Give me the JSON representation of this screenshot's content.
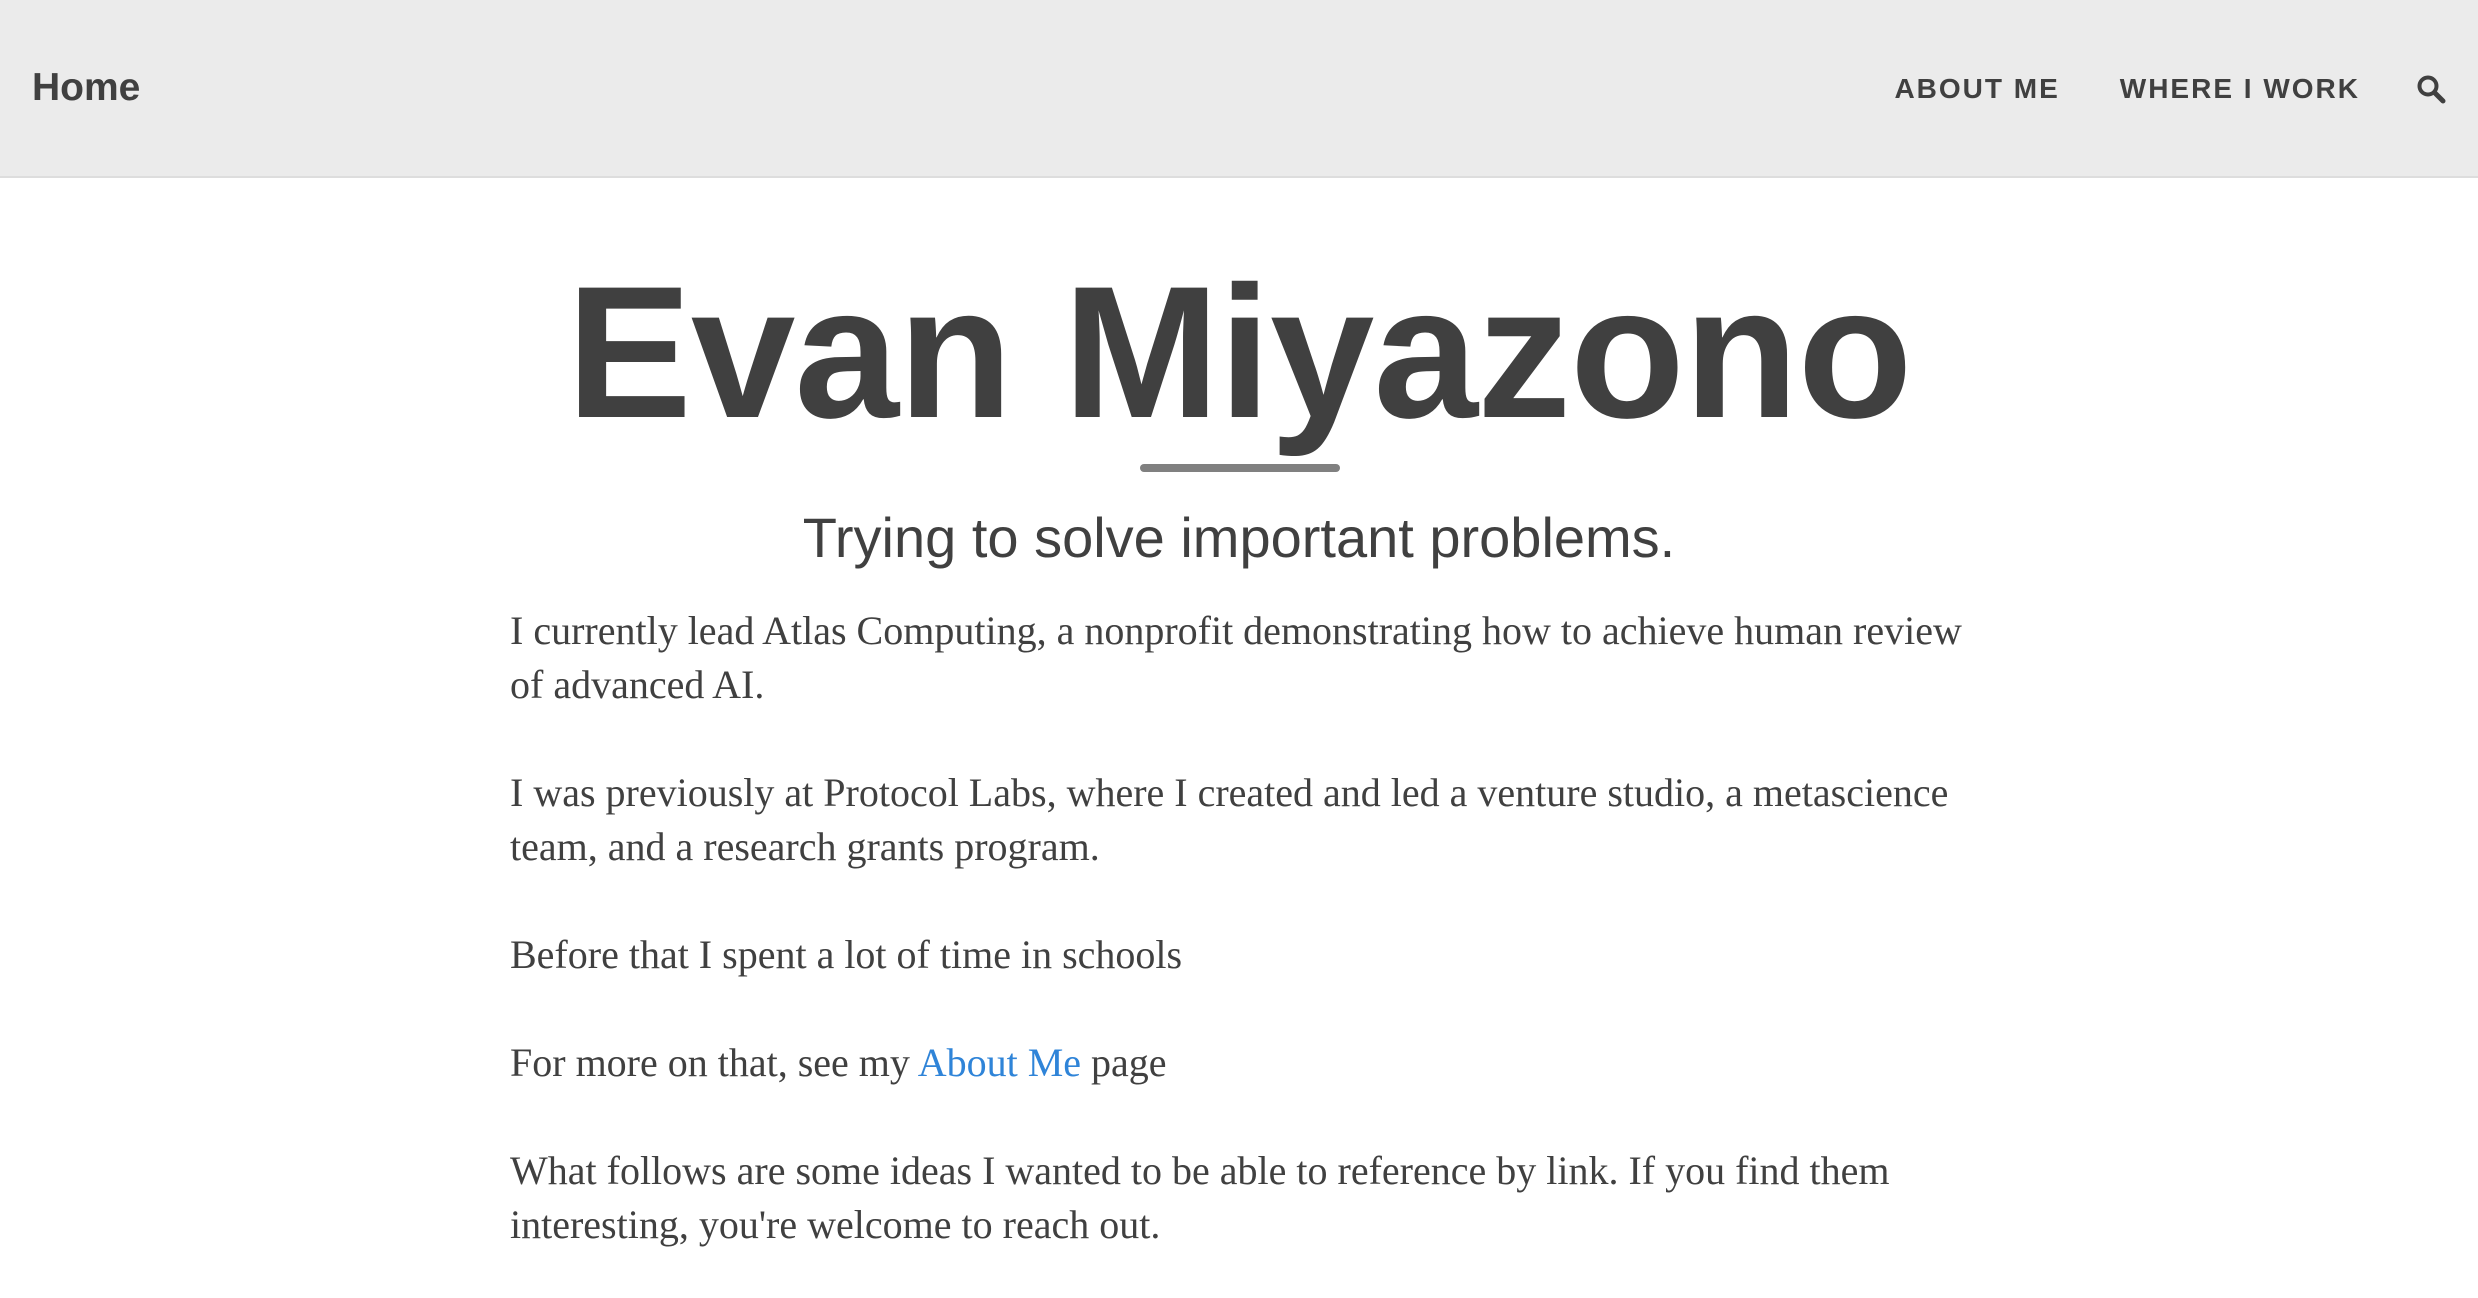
{
  "nav": {
    "brand": "Home",
    "links": [
      {
        "label": "ABOUT ME"
      },
      {
        "label": "WHERE I WORK"
      }
    ],
    "search_icon": "search-icon"
  },
  "hero": {
    "title": "Evan Miyazono",
    "subtitle": "Trying to solve important problems."
  },
  "content": {
    "paragraphs": [
      "I currently lead Atlas Computing, a nonprofit demonstrating how to achieve human review of advanced AI.",
      "I was previously at Protocol Labs, where I created and led a venture studio, a metascience team, and a research grants program.",
      "Before that I spent a lot of time in schools"
    ],
    "more_prefix": "For more on that, see my ",
    "more_link": "About Me",
    "more_suffix": " page",
    "closing": "What follows are some ideas I wanted to be able to reference by link. If you find them interesting, you're welcome to reach out."
  },
  "colors": {
    "navbar_bg": "#ebebeb",
    "text": "#404040",
    "link": "#2f84d8",
    "divider": "#808080"
  }
}
